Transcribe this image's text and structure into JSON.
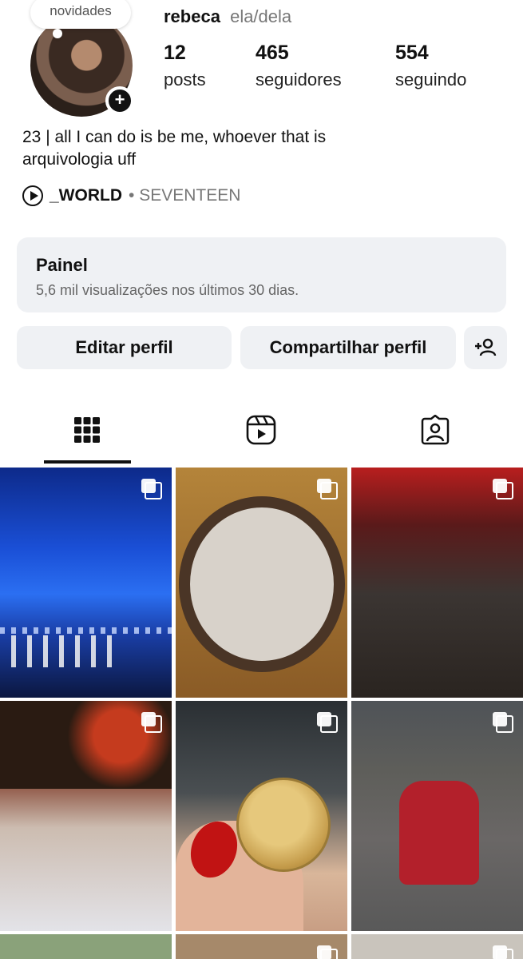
{
  "profile": {
    "note": "novidades",
    "name": "rebeca",
    "pronouns": "ela/dela",
    "stats": [
      {
        "count": "12",
        "label": "posts"
      },
      {
        "count": "465",
        "label": "seguidores"
      },
      {
        "count": "554",
        "label": "seguindo"
      }
    ],
    "bio": [
      "23 | all I can do is be me, whoever that is",
      "arquivologia uff"
    ],
    "music": {
      "song": "_WORLD",
      "separator": "•",
      "artist": "SEVENTEEN",
      "icon": "play-circle-icon"
    }
  },
  "panel": {
    "title": "Painel",
    "subtitle": "5,6 mil visualizações nos últimos 30 dias."
  },
  "buttons": {
    "edit": "Editar perfil",
    "share": "Compartilhar perfil",
    "discover_icon": "add-person-icon"
  },
  "tabs": [
    {
      "icon": "grid-icon",
      "active": true
    },
    {
      "icon": "reels-icon",
      "active": false
    },
    {
      "icon": "tagged-icon",
      "active": false
    }
  ],
  "grid": {
    "posts": [
      {
        "multi": true
      },
      {
        "multi": true
      },
      {
        "multi": true
      },
      {
        "multi": true
      },
      {
        "multi": true
      },
      {
        "multi": true
      },
      {
        "multi": false
      },
      {
        "multi": true
      },
      {
        "multi": true
      }
    ]
  }
}
